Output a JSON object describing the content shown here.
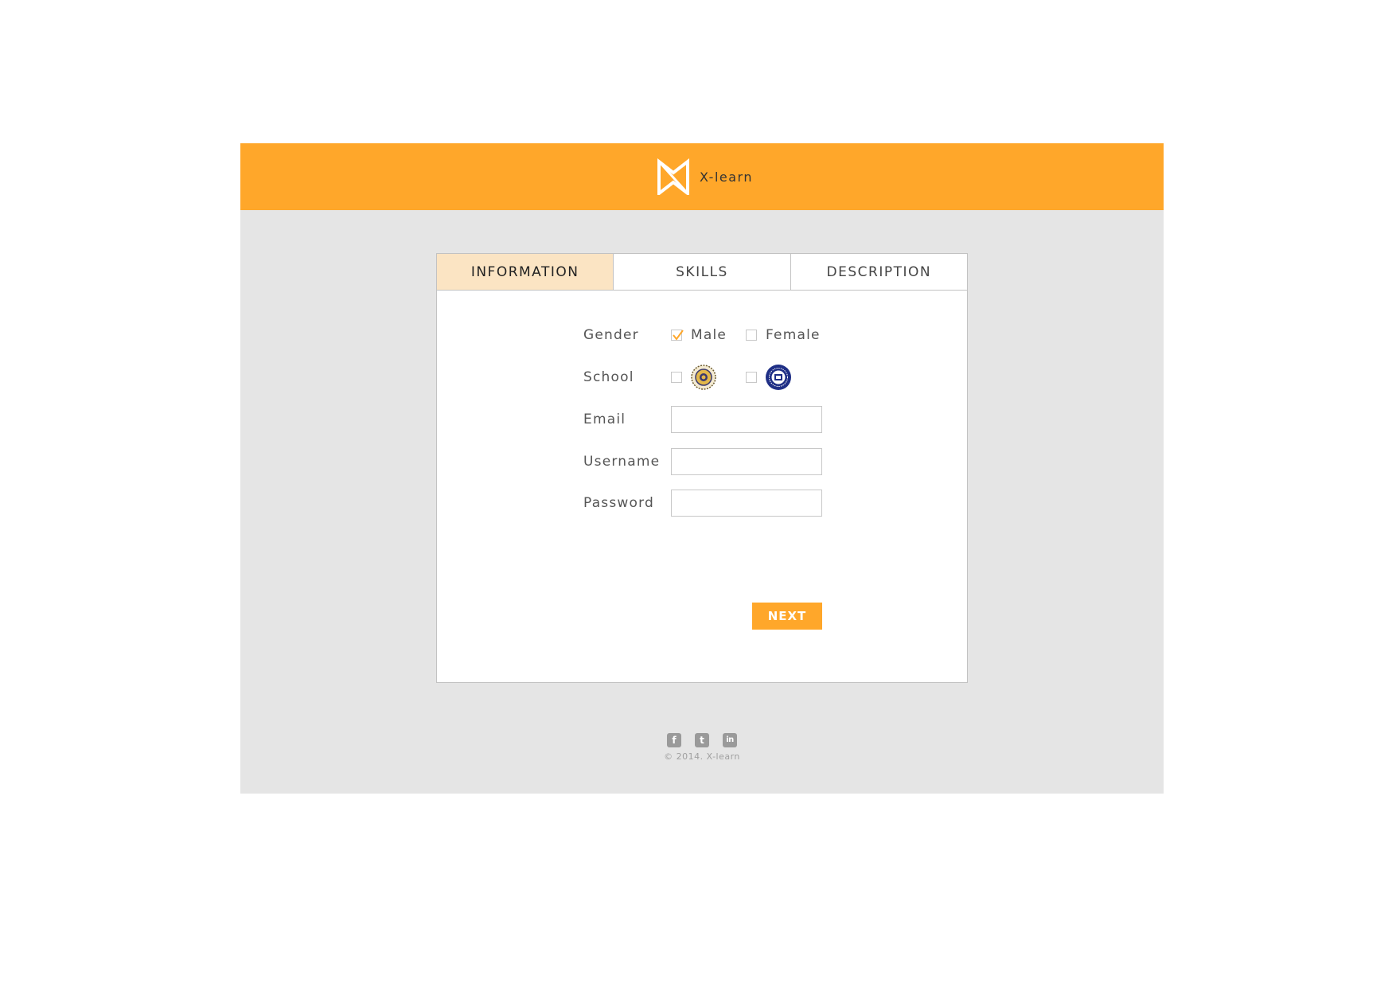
{
  "header": {
    "brand_name": "X-learn",
    "background_color": "#ffa72a",
    "logo_icon": "x-learn-logo-icon"
  },
  "tabs": [
    {
      "label": "INFORMATION",
      "active": true
    },
    {
      "label": "SKILLS",
      "active": false
    },
    {
      "label": "DESCRIPTION",
      "active": false
    }
  ],
  "form": {
    "gender": {
      "label": "Gender",
      "options": [
        {
          "label": "Male",
          "checked": true
        },
        {
          "label": "Female",
          "checked": false
        }
      ]
    },
    "school": {
      "label": "School",
      "options": [
        {
          "icon": "school-seal-gold-icon",
          "checked": false
        },
        {
          "icon": "school-seal-blue-icon",
          "checked": false
        }
      ]
    },
    "email": {
      "label": "Email",
      "value": ""
    },
    "username": {
      "label": "Username",
      "value": ""
    },
    "password": {
      "label": "Password",
      "value": ""
    },
    "next_label": "NEXT"
  },
  "footer": {
    "social": [
      {
        "icon": "facebook-icon",
        "glyph": "f"
      },
      {
        "icon": "twitter-icon",
        "glyph": "t"
      },
      {
        "icon": "linkedin-icon",
        "glyph": "in"
      }
    ],
    "copyright": "© 2014. X-learn"
  },
  "colors": {
    "accent": "#ffa72a",
    "active_tab": "#fbe4c3",
    "page_background": "#e5e5e5"
  }
}
